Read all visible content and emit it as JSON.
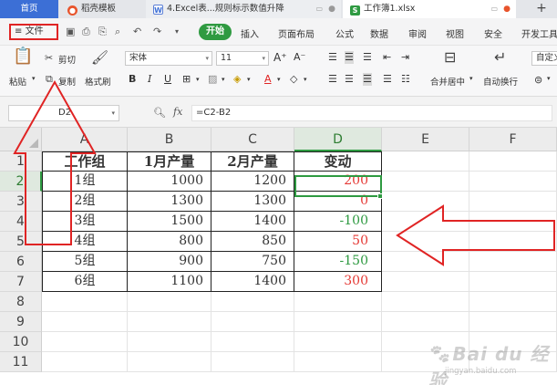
{
  "tabs": {
    "home": "首页",
    "templates": "稻壳模板",
    "doc": "4.Excel表...规则标示数值升降",
    "active": "工作簿1.xlsx",
    "doc_icon_letter": "W",
    "active_icon_letter": "S"
  },
  "menu": {
    "file": "文件",
    "start": "开始",
    "items": [
      "插入",
      "页面布局",
      "公式",
      "数据",
      "审阅",
      "视图",
      "安全",
      "开发工具"
    ]
  },
  "ribbon": {
    "paste": "粘贴",
    "cut": "剪切",
    "copy": "复制",
    "format_painter": "格式刷",
    "font_name": "宋体",
    "font_size": "11",
    "merge_center": "合并居中",
    "wrap_text": "自动换行",
    "custom": "自定义"
  },
  "formula_bar": {
    "name_box": "D2",
    "fx": "fx",
    "formula": "=C2-B2"
  },
  "columns": [
    "A",
    "B",
    "C",
    "D",
    "E",
    "F"
  ],
  "rows": [
    "1",
    "2",
    "3",
    "4",
    "5",
    "6",
    "7",
    "8",
    "9",
    "10",
    "11"
  ],
  "selected_column": "D",
  "selected_row": "2",
  "table": {
    "headers": [
      "工作组",
      "1月产量",
      "2月产量",
      "变动"
    ],
    "rows": [
      [
        "1组",
        "1000",
        "1200",
        "200"
      ],
      [
        "2组",
        "1300",
        "1300",
        "0"
      ],
      [
        "3组",
        "1500",
        "1400",
        "-100"
      ],
      [
        "4组",
        "800",
        "850",
        "50"
      ],
      [
        "5组",
        "900",
        "750",
        "-150"
      ],
      [
        "6组",
        "1100",
        "1400",
        "300"
      ]
    ]
  },
  "colors": {
    "accent_green": "#2e9a41",
    "increase_red": "#e53935",
    "decrease_green": "#2e9a41",
    "annotation_red": "#e02424",
    "tab_blue": "#3c6fd6"
  },
  "watermark": {
    "brand": "Bai du 经验",
    "url": "jingyan.baidu.com"
  }
}
